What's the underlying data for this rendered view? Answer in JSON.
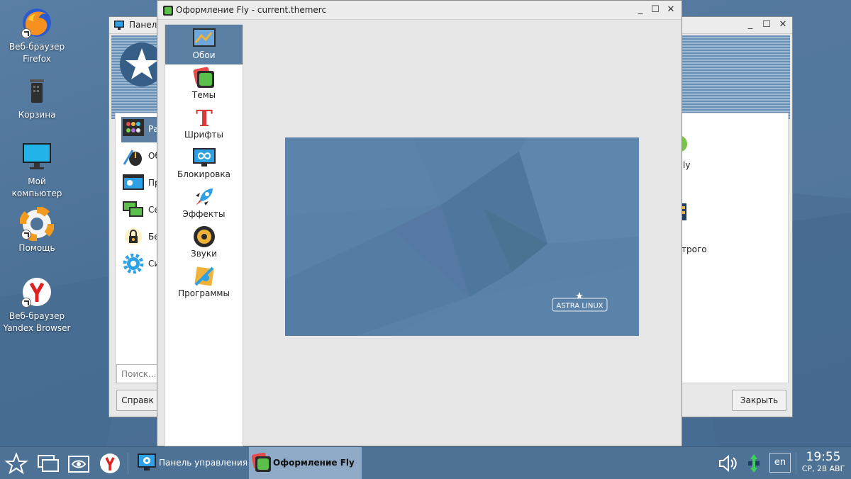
{
  "desktop": {
    "icons": [
      {
        "label": "Веб-браузер\nFirefox",
        "line1": "Веб-браузер",
        "line2": "Firefox"
      },
      {
        "label": "Корзина"
      },
      {
        "line1": "Мой",
        "line2": "компьютер"
      },
      {
        "label": "Помощь"
      },
      {
        "line1": "Веб-браузер",
        "line2": "Yandex Browser"
      }
    ]
  },
  "back_window": {
    "title": "Панель управления",
    "title_visible": "Панель",
    "items": [
      "Раб",
      "Об",
      "Про",
      "Сет",
      "Без",
      "Сис"
    ],
    "right_items": [
      "ly",
      "",
      "трого"
    ],
    "search_placeholder": "Поиск...",
    "help_button": "Справк",
    "close_button": "Закрыть"
  },
  "front_window": {
    "title": "Оформление Fly - current.themerc",
    "categories": [
      {
        "label": "Обои",
        "active": true
      },
      {
        "label": "Темы"
      },
      {
        "label": "Шрифты"
      },
      {
        "label": "Блокировка"
      },
      {
        "label": "Эффекты"
      },
      {
        "label": "Звуки"
      },
      {
        "label": "Программы"
      }
    ],
    "wallpaper_brand": "ASTRA LINUX"
  },
  "taskbar": {
    "tasks": [
      {
        "label": "Панель управления",
        "active": false
      },
      {
        "label": "Оформление Fly",
        "active": true
      }
    ],
    "lang": "en",
    "time": "19:55",
    "date": "СР, 28 АВГ"
  },
  "colors": {
    "desktop": "#4f7498",
    "taskbar": "#4d7296",
    "active_category": "#5b7fa3",
    "wallpaper": "#5a82a8"
  }
}
